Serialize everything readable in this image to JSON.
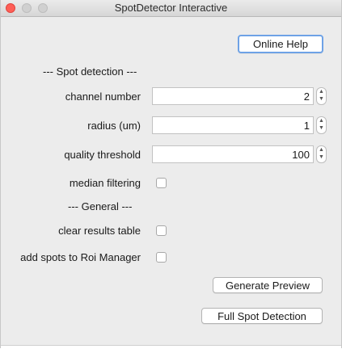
{
  "window": {
    "title": "SpotDetector Interactive"
  },
  "buttons": {
    "online_help": "Online Help",
    "generate_preview": "Generate Preview",
    "full_detection": "Full Spot Detection"
  },
  "spot_detection": {
    "header": "---  Spot detection  ---",
    "channel_label": "channel number",
    "channel_value": "2",
    "radius_label": "radius (um)",
    "radius_value": "1",
    "quality_label": "quality threshold",
    "quality_value": "100",
    "median_label": "median filtering"
  },
  "general": {
    "header": "---  General  ---",
    "clear_label": "clear results table",
    "roi_label": "add spots to Roi Manager"
  },
  "icons": {
    "stepper_up": "▲",
    "stepper_down": "▼"
  }
}
